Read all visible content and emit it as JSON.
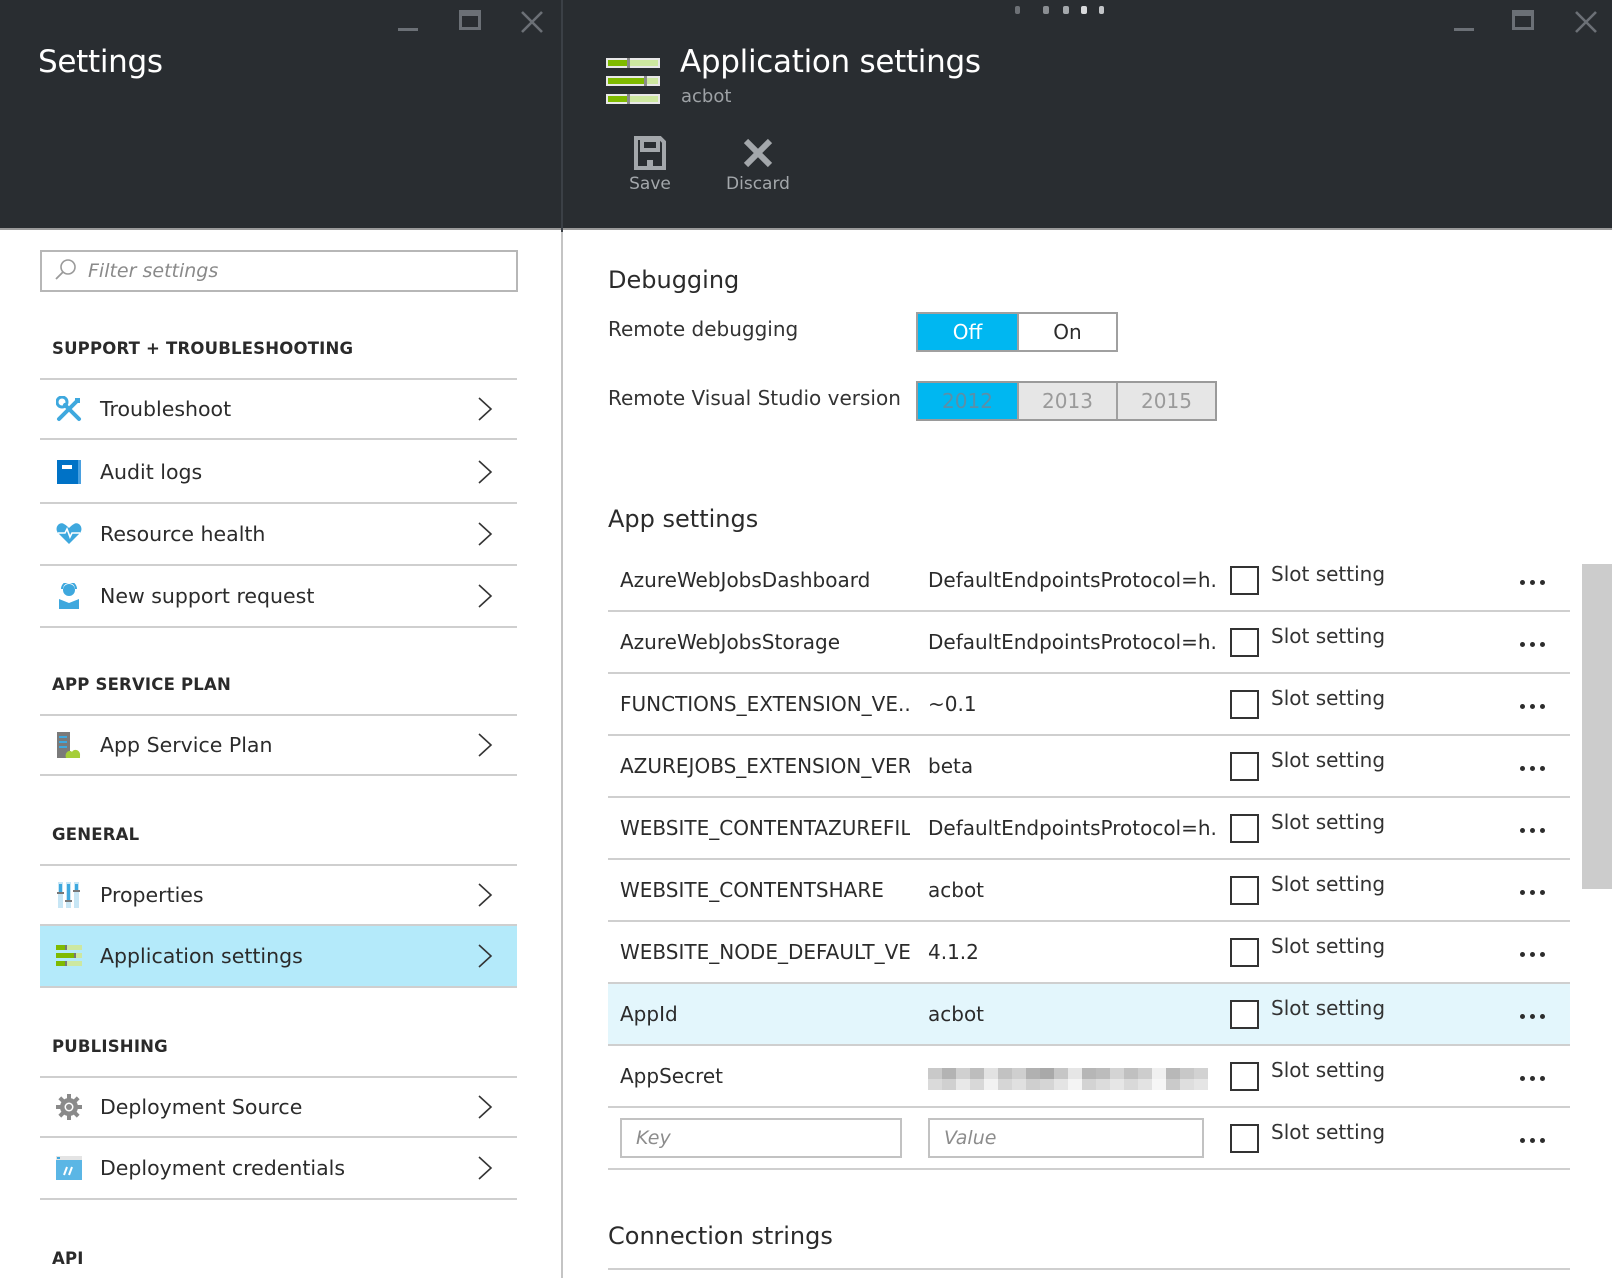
{
  "left_blade": {
    "title": "Settings",
    "filter_placeholder": "Filter settings",
    "sections": [
      {
        "label": "SUPPORT + TROUBLESHOOTING",
        "items": [
          {
            "label": "Troubleshoot",
            "icon": "wrench-screwdriver-icon"
          },
          {
            "label": "Audit logs",
            "icon": "audit-log-book-icon"
          },
          {
            "label": "Resource health",
            "icon": "heart-pulse-icon"
          },
          {
            "label": "New support request",
            "icon": "support-person-icon"
          }
        ]
      },
      {
        "label": "APP SERVICE PLAN",
        "items": [
          {
            "label": "App Service Plan",
            "icon": "server-cloud-icon"
          }
        ]
      },
      {
        "label": "GENERAL",
        "items": [
          {
            "label": "Properties",
            "icon": "properties-sliders-icon"
          },
          {
            "label": "Application settings",
            "icon": "app-settings-icon",
            "active": true
          }
        ]
      },
      {
        "label": "PUBLISHING",
        "items": [
          {
            "label": "Deployment Source",
            "icon": "gear-icon"
          },
          {
            "label": "Deployment credentials",
            "icon": "credentials-window-icon"
          }
        ]
      },
      {
        "label": "API",
        "items": []
      }
    ]
  },
  "right_blade": {
    "title": "Application settings",
    "subtitle": "acbot",
    "commands": [
      {
        "label": "Save",
        "icon": "save-icon"
      },
      {
        "label": "Discard",
        "icon": "discard-x-icon"
      }
    ],
    "debugging": {
      "heading": "Debugging",
      "remote_debugging": {
        "label": "Remote debugging",
        "options": [
          "Off",
          "On"
        ],
        "selected": "Off"
      },
      "vs_version": {
        "label": "Remote Visual Studio version",
        "options": [
          "2012",
          "2013",
          "2015"
        ],
        "selected": "2012",
        "disabled": true
      }
    },
    "app_settings": {
      "heading": "App settings",
      "slot_label": "Slot setting",
      "rows": [
        {
          "key": "AzureWebJobsDashboard",
          "value": "DefaultEndpointsProtocol=h...",
          "slot": false
        },
        {
          "key": "AzureWebJobsStorage",
          "value": "DefaultEndpointsProtocol=h...",
          "slot": false
        },
        {
          "key": "FUNCTIONS_EXTENSION_VE...",
          "value": "~0.1",
          "slot": false
        },
        {
          "key": "AZUREJOBS_EXTENSION_VER..",
          "value": "beta",
          "slot": false
        },
        {
          "key": "WEBSITE_CONTENTAZUREFIL..",
          "value": "DefaultEndpointsProtocol=h...",
          "slot": false
        },
        {
          "key": "WEBSITE_CONTENTSHARE",
          "value": "acbot",
          "slot": false
        },
        {
          "key": "WEBSITE_NODE_DEFAULT_VE..",
          "value": "4.1.2",
          "slot": false
        },
        {
          "key": "AppId",
          "value": "acbot",
          "slot": false,
          "highlighted": true
        },
        {
          "key": "AppSecret",
          "value": "",
          "slot": false,
          "redacted": true
        }
      ],
      "new_row": {
        "key_placeholder": "Key",
        "value_placeholder": "Value"
      }
    },
    "connection_strings": {
      "heading": "Connection strings"
    }
  },
  "colors": {
    "header_bg": "#292d31",
    "accent_blue": "#00b7f1",
    "active_nav_bg": "#b4eafa",
    "highlight_row_bg": "#e3f6fc",
    "icon_green": "#7fba00"
  }
}
